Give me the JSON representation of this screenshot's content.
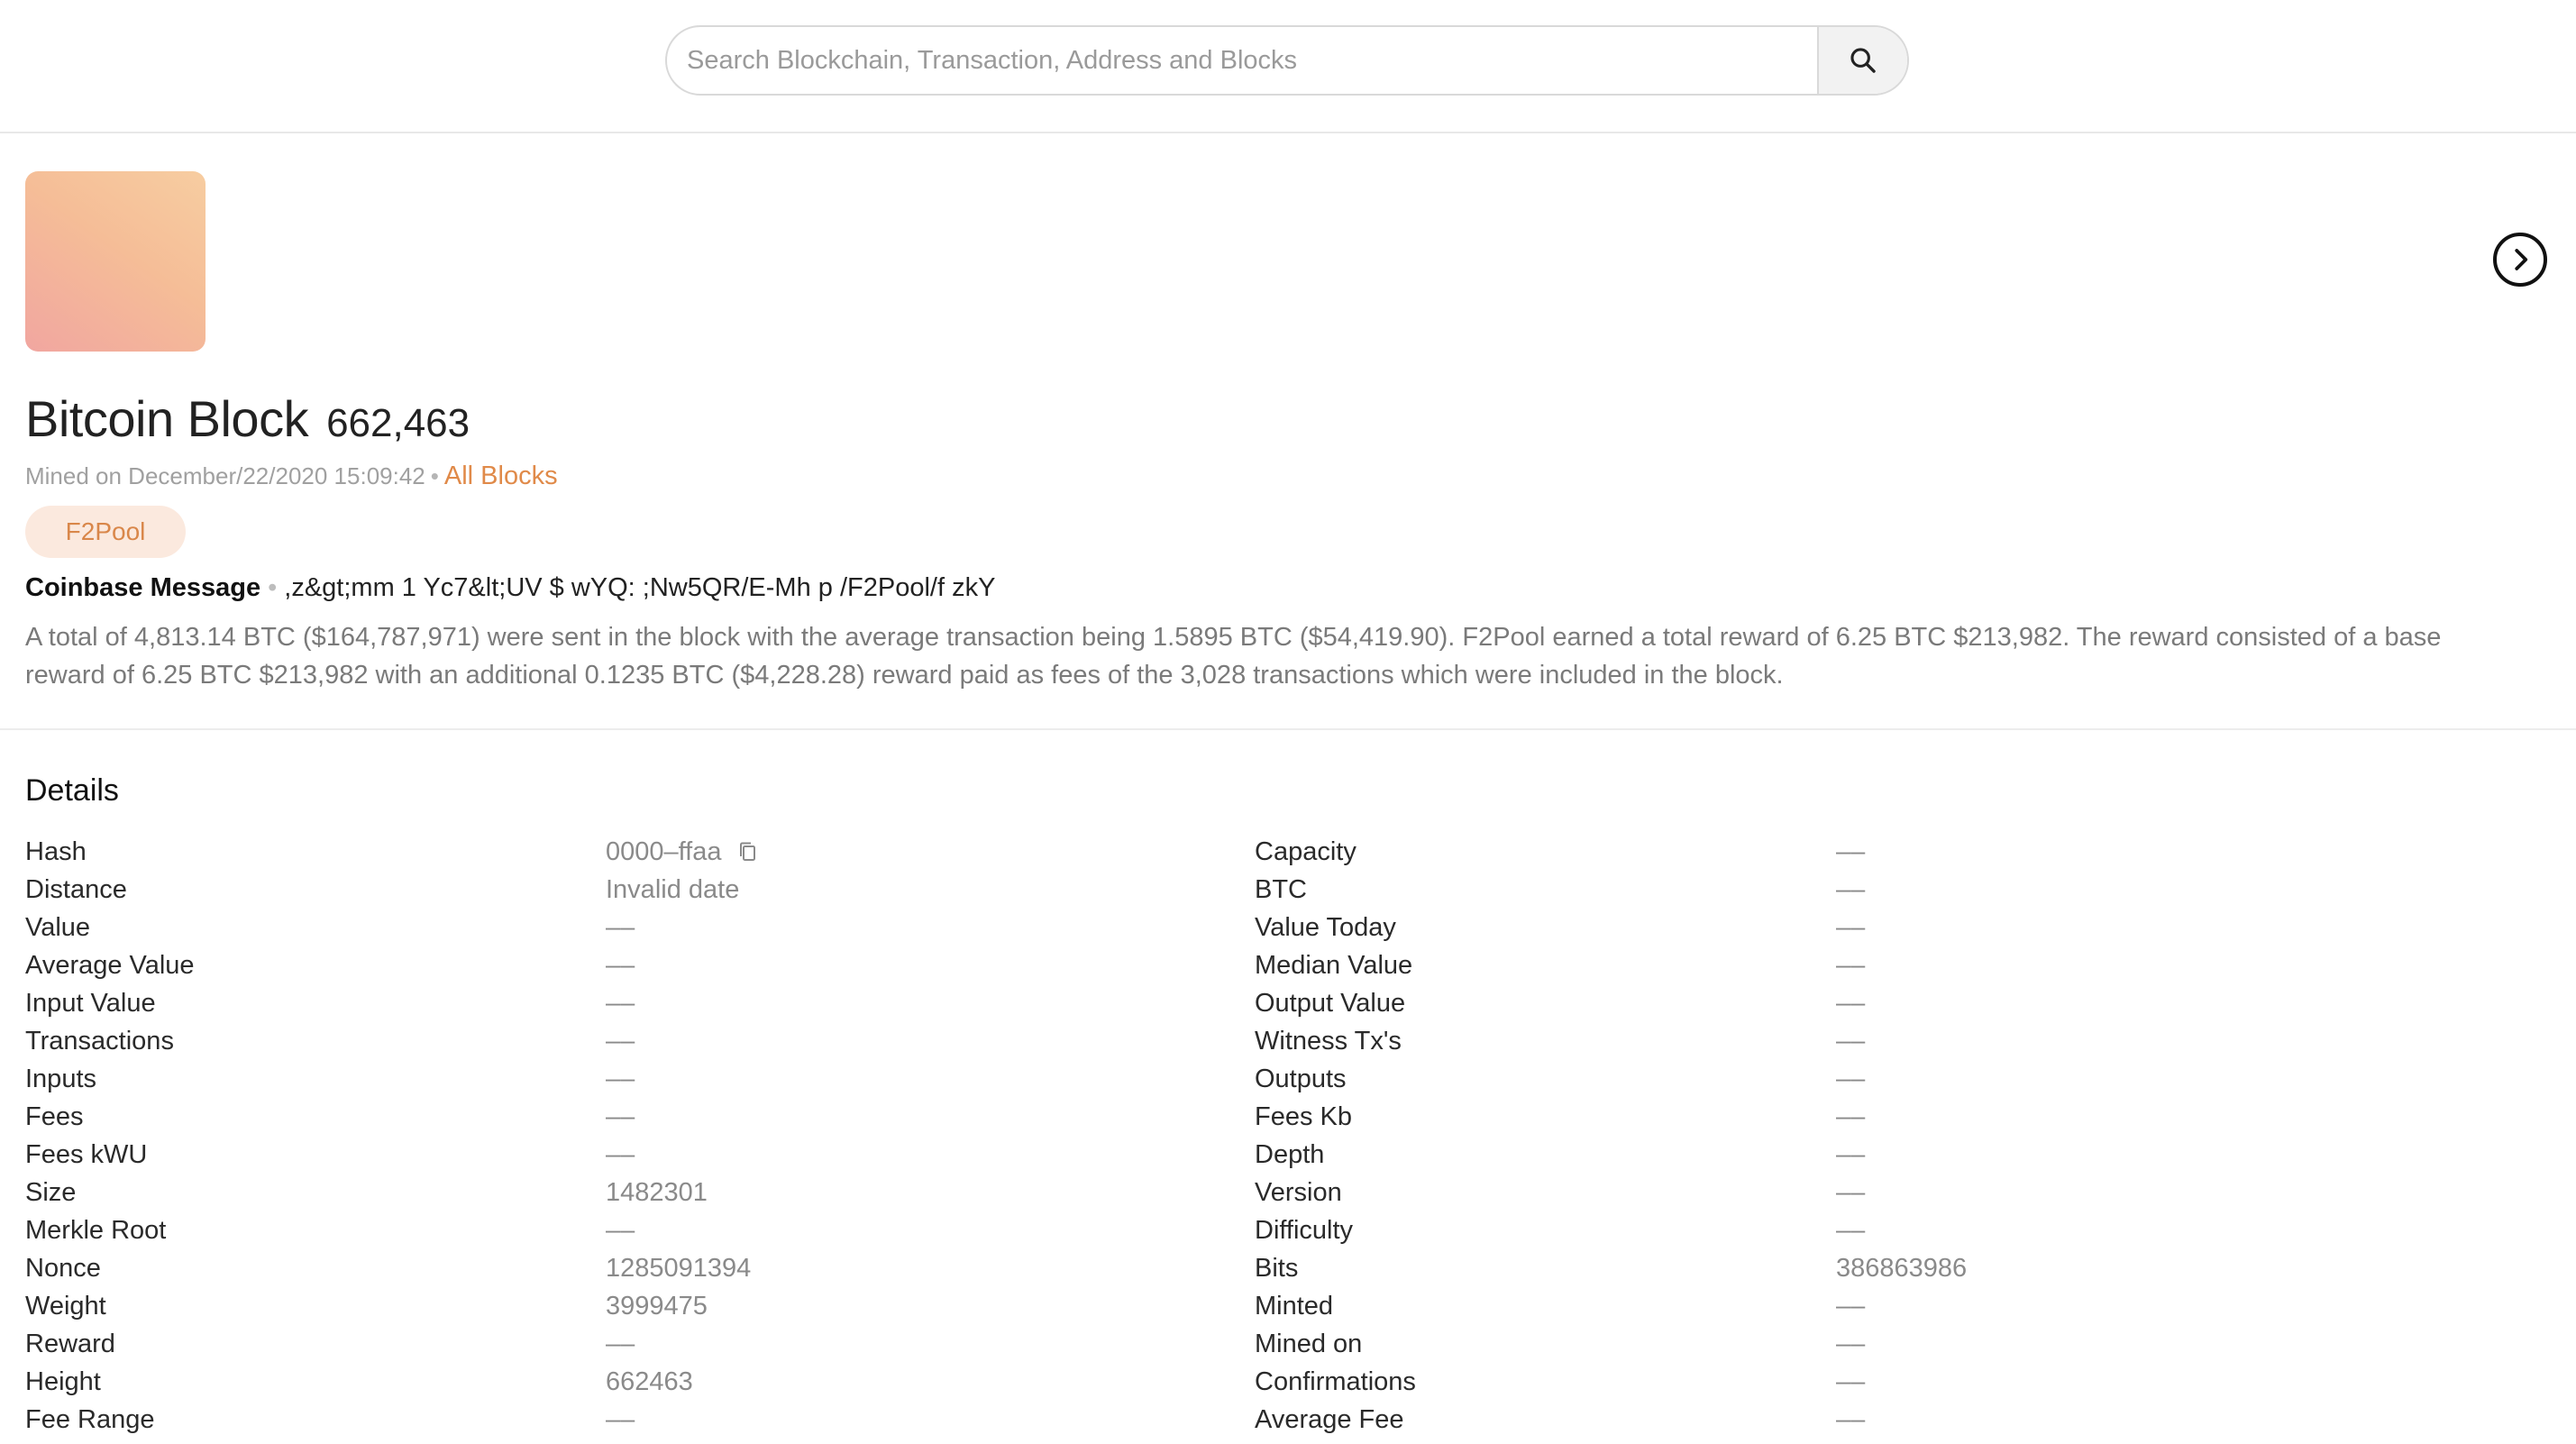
{
  "search": {
    "placeholder": "Search Blockchain, Transaction, Address and Blocks",
    "button_icon": "search-icon"
  },
  "block": {
    "title": "Bitcoin Block",
    "height": "662,463",
    "mined_text": "Mined on December/22/2020 15:09:42",
    "all_blocks_link": "All Blocks",
    "pool": "F2Pool",
    "coinbase_label": "Coinbase Message",
    "coinbase_message": ",z&gt;mm 1 Yc7&lt;UV $ wYQ: ;Nw5QR/E-Mh p /F2Pool/f zkY",
    "summary": "A total of 4,813.14 BTC ($164,787,971) were sent in the block with the average transaction being 1.5895 BTC ($54,419.90). F2Pool earned a total reward of 6.25 BTC $213,982. The reward consisted of a base reward of 6.25 BTC $213,982 with an additional 0.1235 BTC ($4,228.28) reward paid as fees of the 3,028 transactions which were included in the block."
  },
  "details": {
    "title": "Details",
    "left": [
      {
        "label": "Hash",
        "value": "0000–ffaa"
      },
      {
        "label": "Distance",
        "value": "Invalid date"
      },
      {
        "label": "Value",
        "value": "––"
      },
      {
        "label": "Average Value",
        "value": "––"
      },
      {
        "label": "Input Value",
        "value": "––"
      },
      {
        "label": "Transactions",
        "value": "––"
      },
      {
        "label": "Inputs",
        "value": "––"
      },
      {
        "label": "Fees",
        "value": "––"
      },
      {
        "label": "Fees kWU",
        "value": "––"
      },
      {
        "label": "Size",
        "value": "1482301"
      },
      {
        "label": "Merkle Root",
        "value": "––"
      },
      {
        "label": "Nonce",
        "value": "1285091394"
      },
      {
        "label": "Weight",
        "value": "3999475"
      },
      {
        "label": "Reward",
        "value": "––"
      },
      {
        "label": "Height",
        "value": "662463"
      },
      {
        "label": "Fee Range",
        "value": "––"
      }
    ],
    "right": [
      {
        "label": "Capacity",
        "value": "––"
      },
      {
        "label": "BTC",
        "value": "––"
      },
      {
        "label": "Value Today",
        "value": "––"
      },
      {
        "label": "Median Value",
        "value": "––"
      },
      {
        "label": "Output Value",
        "value": "––"
      },
      {
        "label": "Witness Tx's",
        "value": "––"
      },
      {
        "label": "Outputs",
        "value": "––"
      },
      {
        "label": "Fees Kb",
        "value": "––"
      },
      {
        "label": "Depth",
        "value": "––"
      },
      {
        "label": "Version",
        "value": "––"
      },
      {
        "label": "Difficulty",
        "value": "––"
      },
      {
        "label": "Bits",
        "value": "386863986"
      },
      {
        "label": "Minted",
        "value": "––"
      },
      {
        "label": "Mined on",
        "value": "––"
      },
      {
        "label": "Confirmations",
        "value": "––"
      },
      {
        "label": "Average Fee",
        "value": "––"
      }
    ]
  },
  "colors": {
    "accent": "#e08a49",
    "badge_bg": "#fbe9de"
  }
}
